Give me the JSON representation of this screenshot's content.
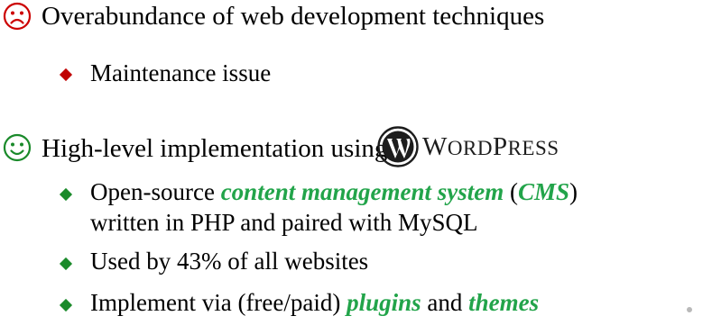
{
  "colors": {
    "sad_face": "#cc0000",
    "happy_face": "#1a8a2a",
    "diamond_red": "#c00000",
    "diamond_green": "#1a8a2a",
    "emphasis_green": "#22a44a",
    "wordpress_logo": "#1d1d1d"
  },
  "icons": {
    "negative": "sad-face-icon",
    "positive": "smiley-face-icon",
    "wordpress": "wordpress-logo-icon"
  },
  "items": [
    {
      "text": "Overabundance of web development techniques",
      "children": [
        {
          "text": "Maintenance issue"
        }
      ]
    },
    {
      "text": "High-level implementation using",
      "logo_text_first": "W",
      "logo_text_rest": "ORD",
      "logo_text_p": "P",
      "logo_text_rest2": "RESS",
      "children": [
        {
          "prefix": "Open-source ",
          "emphasis": "content management system",
          "paren_open": " (",
          "emphasis2": "CMS",
          "paren_close": ")",
          "line2": "written in PHP and paired with MySQL"
        },
        {
          "text": "Used by 43% of all websites"
        },
        {
          "prefix": "Implement via (free/paid) ",
          "emphasis": "plugins",
          "middle": " and ",
          "emphasis2": "themes"
        }
      ]
    }
  ]
}
